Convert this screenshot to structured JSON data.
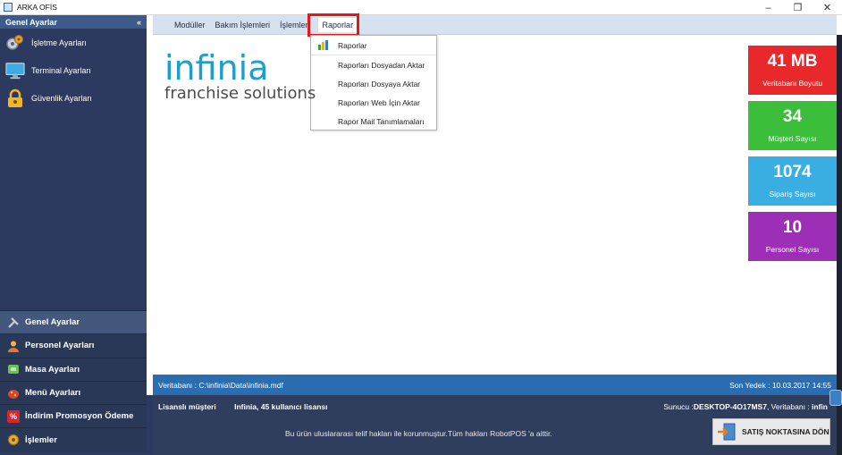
{
  "window": {
    "title": "ARKA OFİS",
    "controls": [
      "–",
      "❐",
      "✕"
    ]
  },
  "sidebar": {
    "header": "Genel Ayarlar",
    "collapse_glyph": "«",
    "top_items": [
      {
        "label": "İşletme Ayarları",
        "icon": "gears-icon"
      },
      {
        "label": "Terminal Ayarları",
        "icon": "monitor-icon"
      },
      {
        "label": "Güvenlik Ayarları",
        "icon": "lock-icon"
      }
    ],
    "bottom_items": [
      {
        "label": "Genel Ayarlar",
        "icon": "tools-icon",
        "color": "#9aa7bd"
      },
      {
        "label": "Personel Ayarları",
        "icon": "person-icon",
        "color": "#e8a33c"
      },
      {
        "label": "Masa Ayarları",
        "icon": "table-icon",
        "color": "#6bbf59"
      },
      {
        "label": "Menü Ayarları",
        "icon": "food-icon",
        "color": "#d9482b"
      },
      {
        "label": "İndirim Promosyon Ödeme",
        "icon": "percent-icon",
        "color": "#d8262e"
      },
      {
        "label": "İşlemler",
        "icon": "gear-icon",
        "color": "#e6b12e"
      }
    ]
  },
  "menubar": {
    "items": [
      "Modüller",
      "Bakım İşlemleri",
      "İşlemler",
      "Raporlar"
    ]
  },
  "dropdown": {
    "items": [
      "Raporlar",
      "Raporları Dosyadan Aktar",
      "Raporları Dosyaya Aktar",
      "Raporları Web İçin Aktar",
      "Rapor Mail Tanımlamaları"
    ]
  },
  "logo": {
    "main": "infinia",
    "sub": "franchise solutions"
  },
  "tiles": [
    {
      "value": "41 MB",
      "label": "Veritabanı Boyutu",
      "color": "#e8282a"
    },
    {
      "value": "34",
      "label": "Müşteri Sayısı",
      "color": "#3bbf3b"
    },
    {
      "value": "1074",
      "label": "Sipariş Sayısı",
      "color": "#3aaee3"
    },
    {
      "value": "10",
      "label": "Personel Sayısı",
      "color": "#9c2fb5"
    }
  ],
  "status": {
    "db_path": "Veritabanı : C:\\infinia\\Data\\infinia.mdf",
    "last_backup": "Son Yedek : 10.03.2017 14:55"
  },
  "footer": {
    "license_label": "Lisanslı müşteri",
    "license_value": "Infinia, 45 kullanıcı lisansı",
    "server_label": "Sunucu :",
    "server_value": "DESKTOP-4O17MS7",
    "db_label": ", Veritabanı :",
    "db_value": "infin",
    "copyright": "Bu ürün uluslararası telif hakları ile korunmuştur.Tüm hakları RobotPOS 'a aittir.",
    "pos_button": "SATIŞ NOKTASINA DÖN"
  }
}
